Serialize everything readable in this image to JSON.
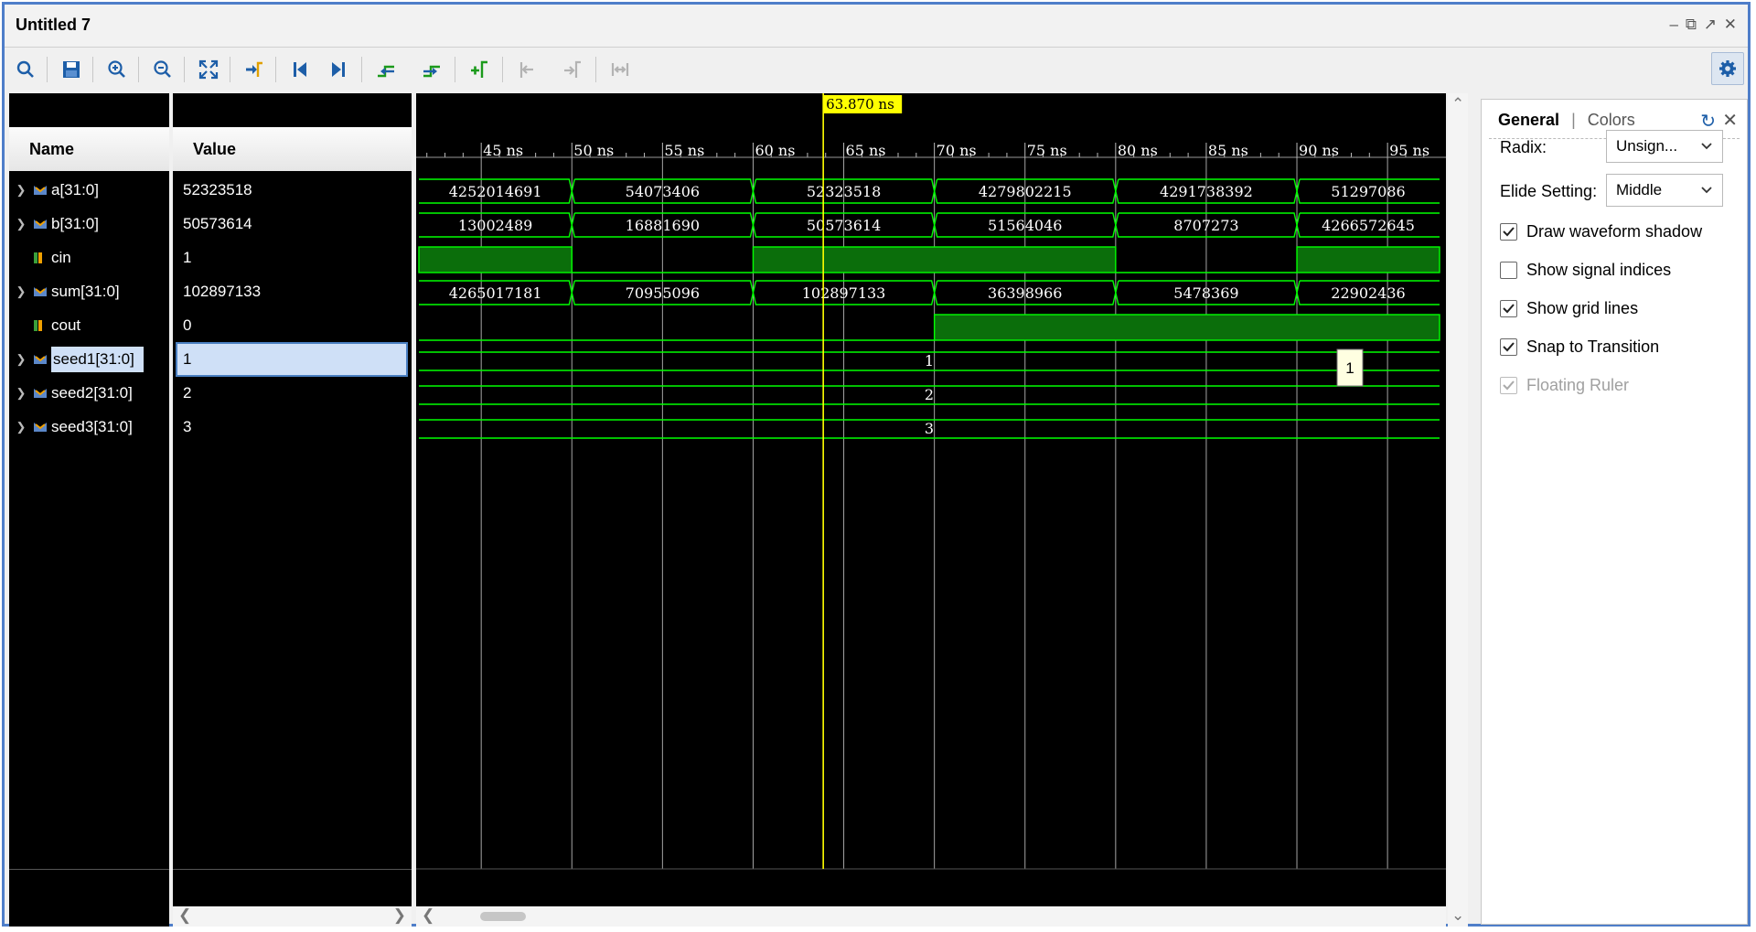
{
  "window": {
    "title": "Untitled 7"
  },
  "columns": {
    "name": "Name",
    "value": "Value"
  },
  "signals": [
    {
      "name": "a[31:0]",
      "value": "52323518",
      "type": "bus"
    },
    {
      "name": "b[31:0]",
      "value": "50573614",
      "type": "bus"
    },
    {
      "name": "cin",
      "value": "1",
      "type": "bit"
    },
    {
      "name": "sum[31:0]",
      "value": "102897133",
      "type": "bus"
    },
    {
      "name": "cout",
      "value": "0",
      "type": "bit"
    },
    {
      "name": "seed1[31:0]",
      "value": "1",
      "type": "bus",
      "selected": true
    },
    {
      "name": "seed2[31:0]",
      "value": "2",
      "type": "bus"
    },
    {
      "name": "seed3[31:0]",
      "value": "3",
      "type": "bus"
    }
  ],
  "waveform": {
    "cursor_label": "63.870 ns",
    "cursor_time": 63.87,
    "time_start": 41.56,
    "time_end": 97.87,
    "ticks": [
      "45 ns",
      "50 ns",
      "55 ns",
      "60 ns",
      "65 ns",
      "70 ns",
      "75 ns",
      "80 ns",
      "85 ns",
      "90 ns",
      "95 ns"
    ],
    "tick_times": [
      45,
      50,
      55,
      60,
      65,
      70,
      75,
      80,
      85,
      90,
      95
    ],
    "a": [
      [
        "4252014691",
        41.56,
        50
      ],
      [
        "54073406",
        50,
        60
      ],
      [
        "52323518",
        60,
        70
      ],
      [
        "4279802215",
        70,
        80
      ],
      [
        "4291738392",
        80,
        90
      ],
      [
        "51297086",
        90,
        97.87
      ]
    ],
    "b": [
      [
        "13002489",
        41.56,
        50
      ],
      [
        "16881690",
        50,
        60
      ],
      [
        "50573614",
        60,
        70
      ],
      [
        "51564046",
        70,
        80
      ],
      [
        "8707273",
        80,
        90
      ],
      [
        "4266572645",
        90,
        97.87
      ]
    ],
    "cin": [
      [
        41.56,
        50,
        1
      ],
      [
        50,
        60,
        0
      ],
      [
        60,
        80,
        1
      ],
      [
        80,
        90,
        0
      ],
      [
        90,
        97.87,
        1
      ]
    ],
    "sum": [
      [
        "4265017181",
        41.56,
        50
      ],
      [
        "70955096",
        50,
        60
      ],
      [
        "102897133",
        60,
        70
      ],
      [
        "36398966",
        70,
        80
      ],
      [
        "5478369",
        80,
        90
      ],
      [
        "22902436",
        90,
        97.87
      ]
    ],
    "cout": [
      [
        41.56,
        70,
        0
      ],
      [
        70,
        97.87,
        1
      ]
    ],
    "seed1": "1",
    "seed2": "2",
    "seed3": "3",
    "tooltip": "1"
  },
  "settings": {
    "tab_general": "General",
    "tab_separator": "|",
    "tab_colors": "Colors",
    "radix_label": "Radix:",
    "radix_value": "Unsign...",
    "elide_label": "Elide Setting:",
    "elide_value": "Middle",
    "options": [
      {
        "label": "Draw waveform shadow",
        "checked": true,
        "enabled": true
      },
      {
        "label": "Show signal indices",
        "checked": false,
        "enabled": true
      },
      {
        "label": "Show grid lines",
        "checked": true,
        "enabled": true
      },
      {
        "label": "Snap to Transition",
        "checked": true,
        "enabled": true
      },
      {
        "label": "Floating Ruler",
        "checked": true,
        "enabled": false
      }
    ]
  },
  "colors": {
    "accent": "#4f7ec9",
    "wave": "#00ff00",
    "wave_fill": "#0b6e0b",
    "cursor": "#ffff00",
    "grid": "#cfcfcf"
  }
}
